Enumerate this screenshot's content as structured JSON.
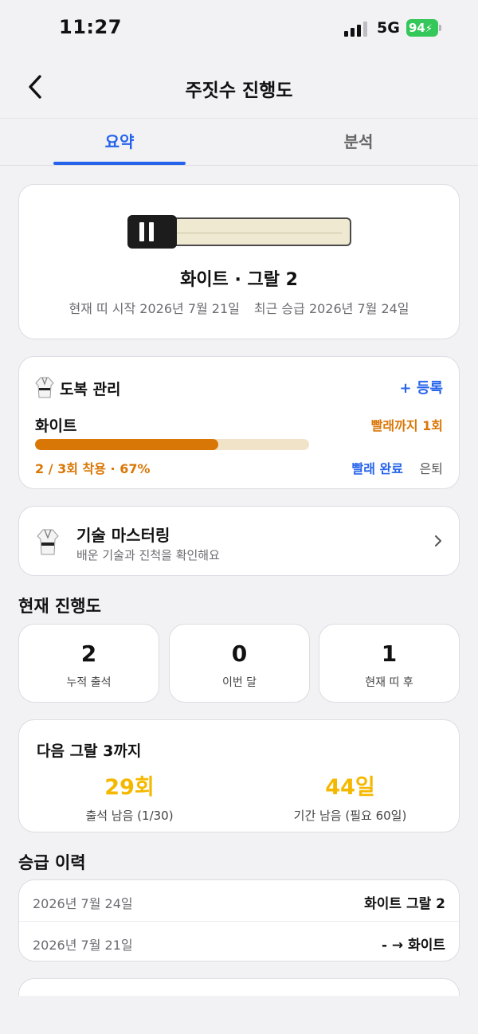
{
  "status_bar": {
    "time": "11:27",
    "network": "5G",
    "battery": "94"
  },
  "nav": {
    "title": "주짓수 진행도"
  },
  "tabs": [
    {
      "label": "요약"
    },
    {
      "label": "분석"
    }
  ],
  "belt": {
    "name": "화이트 · 그랄 2",
    "start_date": "현재 띠 시작 2026년 7월 21일",
    "promotion_date": "최근 승급 2026년 7월 24일",
    "color": "#efe9d2",
    "stripes": 2
  },
  "gi": {
    "title": "도복 관리",
    "add_label": "+ 등록",
    "item_name": "화이트",
    "until_wash": "빨래까지 1회",
    "wear_count": "2 / 3회 착용 · 67%",
    "progress_fraction": 0.67,
    "wash_done_label": "빨래 완료",
    "retire_label": "은퇴",
    "accent_color": "#d97706"
  },
  "technique": {
    "title": "기술 마스터링",
    "subtitle": "배운 기술과 진척을 확인해요"
  },
  "progress": {
    "section_title": "현재 진행도",
    "stats": [
      {
        "value": "2",
        "label": "누적 출석"
      },
      {
        "value": "0",
        "label": "이번 달"
      },
      {
        "value": "1",
        "label": "현재 띠 후"
      }
    ]
  },
  "next_stripe": {
    "title": "다음 그랄 3까지",
    "attendance_value": "29회",
    "attendance_label": "출석 남음 (1/30)",
    "period_value": "44일",
    "period_label": "기간 남음 (필요 60일)"
  },
  "history": {
    "section_title": "승급 이력",
    "rows": [
      {
        "date": "2026년 7월 24일",
        "belt": "화이트 그랄 2"
      },
      {
        "date": "2026년 7월 21일",
        "belt": "- → 화이트"
      }
    ]
  }
}
